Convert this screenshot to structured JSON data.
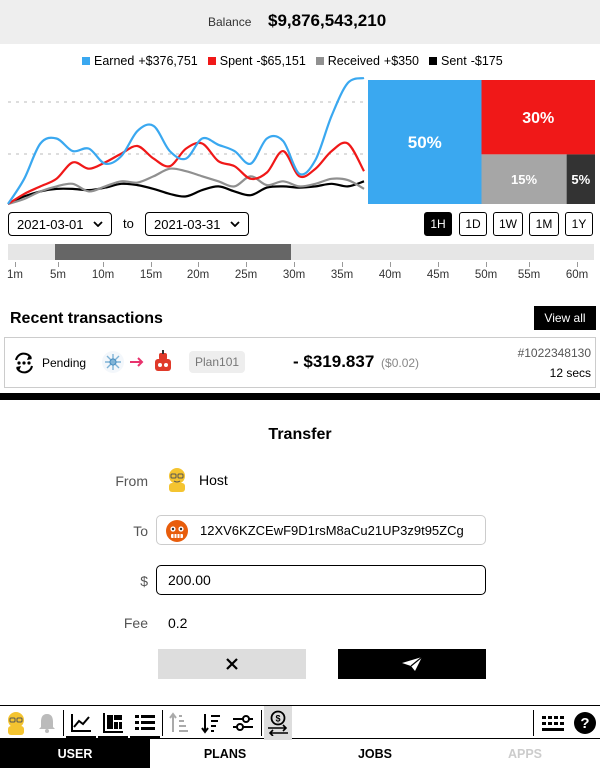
{
  "header": {
    "balance_label": "Balance",
    "balance_value": "$9,876,543,210"
  },
  "legend": [
    {
      "name": "Earned",
      "value": "+$376,751",
      "color": "#3aa8f0"
    },
    {
      "name": "Spent",
      "value": "-$65,151",
      "color": "#f01818"
    },
    {
      "name": "Received",
      "value": "+$350",
      "color": "#909090"
    },
    {
      "name": "Sent",
      "value": "-$175",
      "color": "#000000"
    }
  ],
  "chart_data": [
    {
      "type": "line",
      "series": [
        {
          "name": "Earned",
          "color": "#3aa8f0",
          "values": [
            0,
            20,
            48,
            52,
            42,
            44,
            32,
            38,
            58,
            62,
            42,
            36,
            52,
            47,
            42,
            32,
            52,
            50,
            24,
            35,
            70,
            96,
            100
          ]
        },
        {
          "name": "Spent",
          "color": "#f01818",
          "values": [
            0,
            8,
            14,
            20,
            33,
            28,
            33,
            40,
            46,
            36,
            30,
            44,
            48,
            34,
            30,
            20,
            25,
            42,
            22,
            28,
            42,
            48,
            26
          ]
        },
        {
          "name": "Received",
          "color": "#909090",
          "values": [
            0,
            4,
            10,
            14,
            16,
            10,
            14,
            18,
            17,
            22,
            28,
            26,
            22,
            18,
            14,
            22,
            15,
            18,
            14,
            16,
            20,
            19,
            12
          ]
        },
        {
          "name": "Sent",
          "color": "#000000",
          "values": [
            0,
            6,
            10,
            12,
            12,
            11,
            13,
            16,
            15,
            12,
            8,
            6,
            11,
            14,
            10,
            7,
            13,
            14,
            13,
            14,
            16,
            14,
            18
          ]
        }
      ]
    },
    {
      "type": "treemap",
      "items": [
        {
          "label": "50%",
          "value": 50,
          "color": "#3aa8f0"
        },
        {
          "label": "30%",
          "value": 30,
          "color": "#f01818"
        },
        {
          "label": "15%",
          "value": 15,
          "color": "#a6a6a6"
        },
        {
          "label": "5%",
          "value": 5,
          "color": "#333333"
        }
      ]
    }
  ],
  "date_range": {
    "from": "2021-03-01",
    "to_label": "to",
    "to": "2021-03-31"
  },
  "ranges": [
    "1H",
    "1D",
    "1W",
    "1M",
    "1Y"
  ],
  "active_range": "1H",
  "timeline": {
    "labels": [
      "1m",
      "5m",
      "10m",
      "15m",
      "20m",
      "25m",
      "30m",
      "35m",
      "40m",
      "45m",
      "50m",
      "55m",
      "60m"
    ],
    "selection": [
      "5m",
      "30m"
    ]
  },
  "recent": {
    "title": "Recent transactions",
    "view_all": "View all",
    "tx": {
      "status": "Pending",
      "plan": "Plan101",
      "amount": "- $319.837",
      "fee": "($0.02)",
      "id": "#1022348130",
      "time": "12 secs"
    }
  },
  "transfer": {
    "title": "Transfer",
    "from_label": "From",
    "from_value": "Host",
    "to_label": "To",
    "to_value": "12XV6KZCEwF9D1rsM8aCu21UP3z9t95ZCg",
    "amount_label": "$",
    "amount_value": "200.00",
    "fee_label": "Fee",
    "fee_value": "0.2"
  },
  "toolbar_icons": [
    "avatar-icon",
    "bell-icon",
    "line-chart-icon",
    "grid-chart-icon",
    "list-icon",
    "sort-asc-icon",
    "sort-desc-icon",
    "sliders-icon",
    "transfer-icon",
    "keyboard-icon",
    "help-icon"
  ],
  "tabs": [
    {
      "label": "USER",
      "active": true
    },
    {
      "label": "PLANS"
    },
    {
      "label": "JOBS"
    },
    {
      "label": "APPS",
      "disabled": true
    }
  ]
}
